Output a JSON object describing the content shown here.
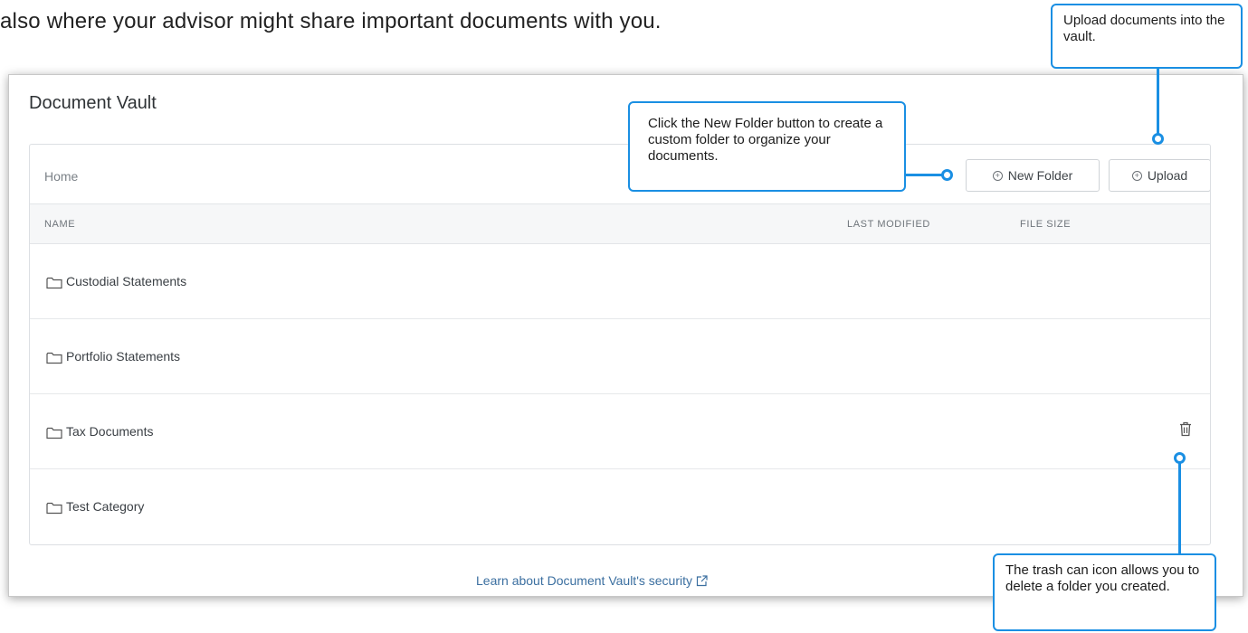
{
  "intro_text": "also where your advisor might share important documents with you.",
  "vault": {
    "title": "Document Vault",
    "breadcrumb": "Home",
    "new_folder_label": "New Folder",
    "upload_label": "Upload",
    "columns": {
      "name": "NAME",
      "last_modified": "LAST MODIFIED",
      "file_size": "FILE SIZE"
    },
    "folders": [
      {
        "name": "Custodial Statements",
        "icon": "folder-icon"
      },
      {
        "name": "Portfolio Statements",
        "icon": "folder-icon"
      },
      {
        "name": "Tax Documents",
        "icon": "folder-icon",
        "has_trash": true
      },
      {
        "name": "Test Category",
        "icon": "folder-icon"
      }
    ],
    "security_link": "Learn about Document Vault's security"
  },
  "callouts": {
    "upload": "Upload documents into the vault.",
    "new_folder": "Click the New Folder button to create a custom folder to organize your documents.",
    "trash": "The trash can icon allows you to delete a folder you created."
  },
  "colors": {
    "accent": "#1a8fe3",
    "link": "#3b6fa0"
  }
}
